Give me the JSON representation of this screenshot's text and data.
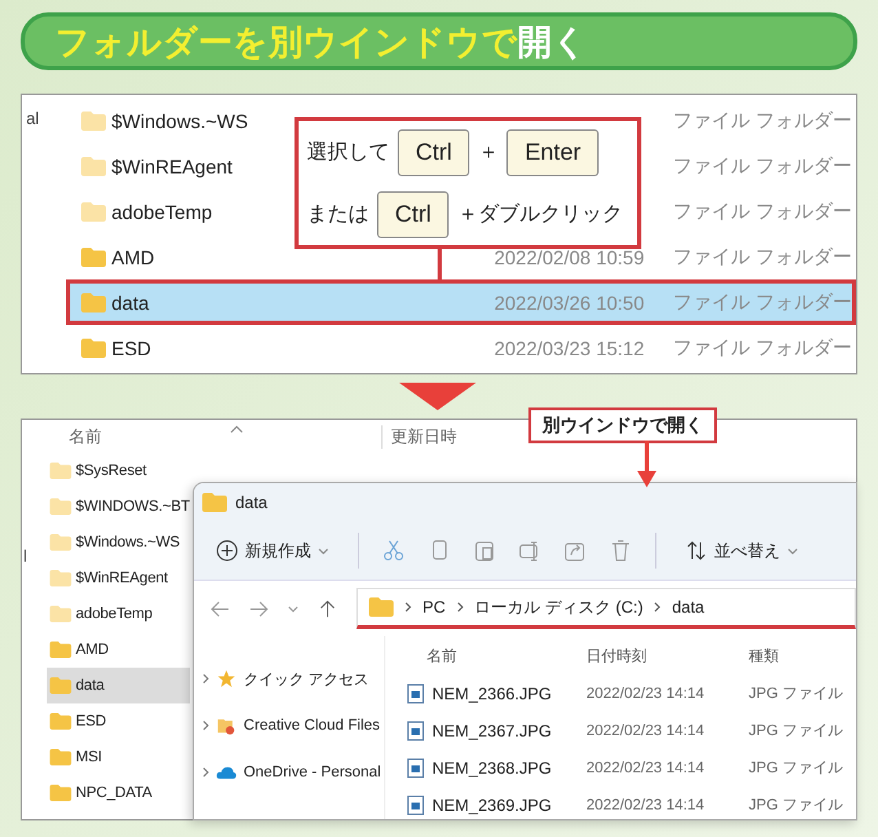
{
  "title": {
    "highlight": "フォルダーを別ウインドウで",
    "rest": "開く"
  },
  "before": {
    "edge_fragment": "al",
    "rows": [
      {
        "name": "$Windows.~WS",
        "hidden": true,
        "type": "ファイル フォルダー",
        "selected": false
      },
      {
        "name": "$WinREAgent",
        "hidden": true,
        "type": "ファイル フォルダー",
        "selected": false
      },
      {
        "name": "adobeTemp",
        "hidden": true,
        "type": "ファイル フォルダー",
        "selected": false
      },
      {
        "name": "AMD",
        "hidden": false,
        "date": "2022/02/08 10:59",
        "type": "ファイル フォルダー",
        "selected": false
      },
      {
        "name": "data",
        "hidden": false,
        "date": "2022/03/26 10:50",
        "type": "ファイル フォルダー",
        "selected": true
      },
      {
        "name": "ESD",
        "hidden": false,
        "date": "2022/03/23 15:12",
        "type": "ファイル フォルダー",
        "selected": false
      }
    ],
    "callout": [
      [
        {
          "kind": "text",
          "text": "選択して"
        },
        {
          "kind": "key",
          "text": "Ctrl"
        },
        {
          "kind": "text",
          "text": "＋"
        },
        {
          "kind": "key",
          "text": "Enter"
        }
      ],
      [
        {
          "kind": "text",
          "text": "または"
        },
        {
          "kind": "key",
          "text": "Ctrl"
        },
        {
          "kind": "text",
          "text": "＋ダブルクリック"
        }
      ]
    ]
  },
  "after": {
    "edge_fragment": "l",
    "columns": [
      "名前",
      "更新日時"
    ],
    "rows": [
      {
        "name": "$SysReset",
        "hidden": true,
        "selected": false
      },
      {
        "name": "$WINDOWS.~BT",
        "hidden": true,
        "selected": false
      },
      {
        "name": "$Windows.~WS",
        "hidden": true,
        "selected": false
      },
      {
        "name": "$WinREAgent",
        "hidden": true,
        "selected": false
      },
      {
        "name": "adobeTemp",
        "hidden": true,
        "selected": false
      },
      {
        "name": "AMD",
        "hidden": false,
        "selected": false
      },
      {
        "name": "data",
        "hidden": false,
        "selected": true
      },
      {
        "name": "ESD",
        "hidden": false,
        "selected": false
      },
      {
        "name": "MSI",
        "hidden": false,
        "selected": false
      },
      {
        "name": "NPC_DATA",
        "hidden": false,
        "selected": false
      }
    ],
    "callout": "別ウインドウで開く",
    "window": {
      "title": "data",
      "new_button": "新規作成",
      "sort_button": "並べ替え",
      "address": [
        "PC",
        "ローカル ディスク (C:)",
        "data"
      ],
      "sidebar": [
        {
          "kind": "star",
          "label": "クイック アクセス"
        },
        {
          "kind": "creative-cloud",
          "label": "Creative Cloud Files"
        },
        {
          "kind": "onedrive",
          "label": "OneDrive - Personal"
        }
      ],
      "columns": [
        "名前",
        "日付時刻",
        "種類"
      ],
      "files": [
        {
          "name": "NEM_2366.JPG",
          "date": "2022/02/23 14:14",
          "type": "JPG ファイル"
        },
        {
          "name": "NEM_2367.JPG",
          "date": "2022/02/23 14:14",
          "type": "JPG ファイル"
        },
        {
          "name": "NEM_2368.JPG",
          "date": "2022/02/23 14:14",
          "type": "JPG ファイル"
        },
        {
          "name": "NEM_2369.JPG",
          "date": "2022/02/23 14:14",
          "type": "JPG ファイル"
        }
      ]
    }
  }
}
